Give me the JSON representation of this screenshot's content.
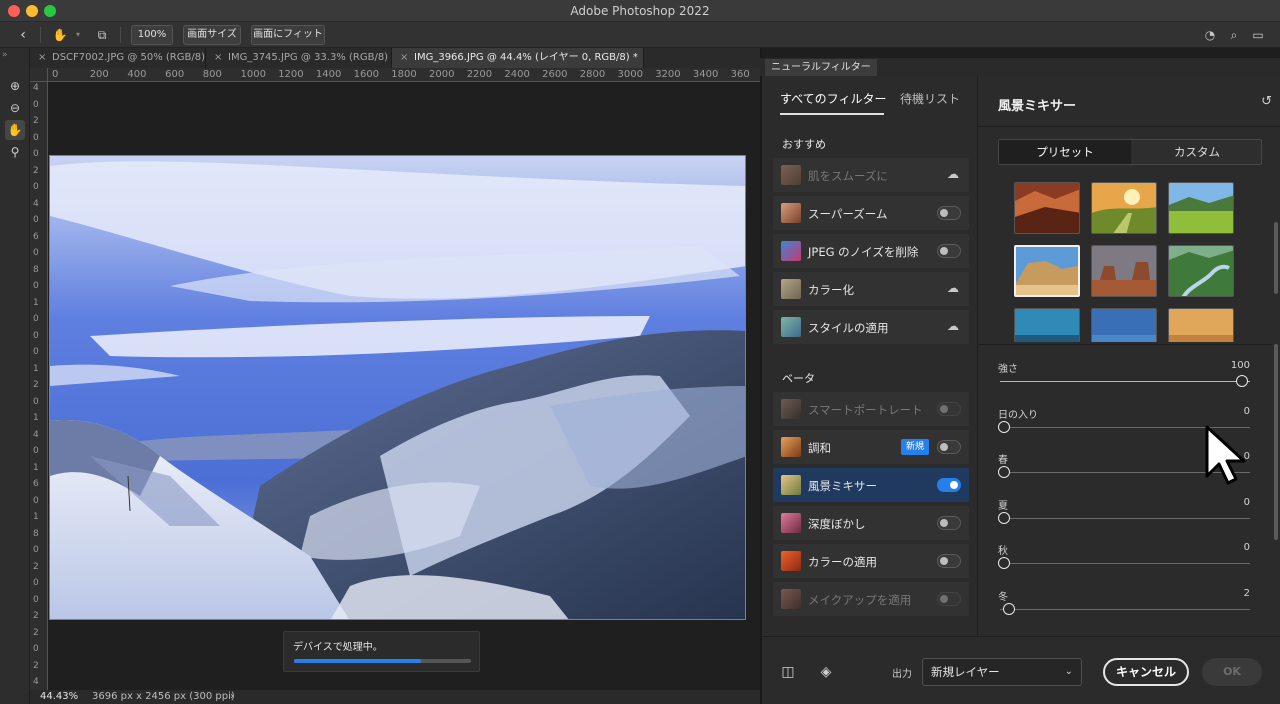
{
  "window": {
    "title": "Adobe Photoshop 2022"
  },
  "optionsbar": {
    "zoom_label": "100%",
    "fit_screen_label": "画面サイズ",
    "fill_screen_label": "画面にフィット"
  },
  "doc_tabs": [
    {
      "label": "DSCF7002.JPG @ 50% (RGB/8)"
    },
    {
      "label": "IMG_3745.JPG @ 33.3% (RGB/8)"
    },
    {
      "label": "IMG_3966.JPG @ 44.4% (レイヤー 0, RGB/8) *"
    }
  ],
  "ruler_top": [
    "0",
    "200",
    "400",
    "600",
    "800",
    "1000",
    "1200",
    "1400",
    "1600",
    "1800",
    "2000",
    "2200",
    "2400",
    "2600",
    "2800",
    "3000",
    "3200",
    "3400",
    "360"
  ],
  "ruler_left": [
    "4",
    "0",
    "2",
    "0",
    "0",
    "2",
    "0",
    "4",
    "0",
    "6",
    "0",
    "8",
    "0",
    "1",
    "0",
    "0",
    "0",
    "1",
    "2",
    "0",
    "1",
    "4",
    "0",
    "1",
    "6",
    "0",
    "1",
    "8",
    "0",
    "2",
    "0",
    "0",
    "2",
    "2",
    "0",
    "2",
    "4"
  ],
  "canvas": {
    "processing_label": "デバイスで処理中。",
    "progress": 0.72
  },
  "status": {
    "zoom": "44.43%",
    "dimensions": "3696 px x 2456 px (300 ppi)",
    "chevron": "›"
  },
  "neural": {
    "panel_tab": "ニューラルフィルター",
    "tab_all": "すべてのフィルター",
    "tab_waitlist": "待機リスト",
    "section_featured": "おすすめ",
    "section_beta": "ベータ",
    "featured": [
      {
        "label": "肌をスムーズに",
        "control": "cloud",
        "disabled": true
      },
      {
        "label": "スーパーズーム",
        "control": "toggle",
        "on": false
      },
      {
        "label": "JPEG のノイズを削除",
        "control": "toggle",
        "on": false
      },
      {
        "label": "カラー化",
        "control": "cloud"
      },
      {
        "label": "スタイルの適用",
        "control": "cloud"
      }
    ],
    "beta": [
      {
        "label": "スマートポートレート",
        "control": "toggle",
        "on": false,
        "disabled": true
      },
      {
        "label": "調和",
        "control": "toggle",
        "on": false,
        "badge": "新規"
      },
      {
        "label": "風景ミキサー",
        "control": "toggle",
        "on": true,
        "selected": true
      },
      {
        "label": "深度ぼかし",
        "control": "toggle",
        "on": false
      },
      {
        "label": "カラーの適用",
        "control": "toggle",
        "on": false
      },
      {
        "label": "メイクアップを適用",
        "control": "toggle",
        "on": false,
        "disabled": true
      }
    ],
    "detail": {
      "title": "風景ミキサー",
      "seg_preset": "プリセット",
      "seg_custom": "カスタム",
      "sliders": [
        {
          "label": "強さ",
          "value": "100",
          "fraction": 1.0
        },
        {
          "label": "日の入り",
          "value": "0",
          "fraction": 0.0
        },
        {
          "label": "春",
          "value": "0",
          "fraction": 0.0
        },
        {
          "label": "夏",
          "value": "0",
          "fraction": 0.0
        },
        {
          "label": "秋",
          "value": "0",
          "fraction": 0.0
        },
        {
          "label": "冬",
          "value": "2",
          "fraction": 0.02
        }
      ]
    },
    "footer": {
      "output_label": "出力",
      "output_value": "新規レイヤー",
      "cancel_label": "キャンセル",
      "ok_label": "OK"
    }
  },
  "colors": {
    "accent": "#2680eb",
    "selection_border": "#3d8bf5",
    "panel_bg": "#2b2b2b"
  }
}
